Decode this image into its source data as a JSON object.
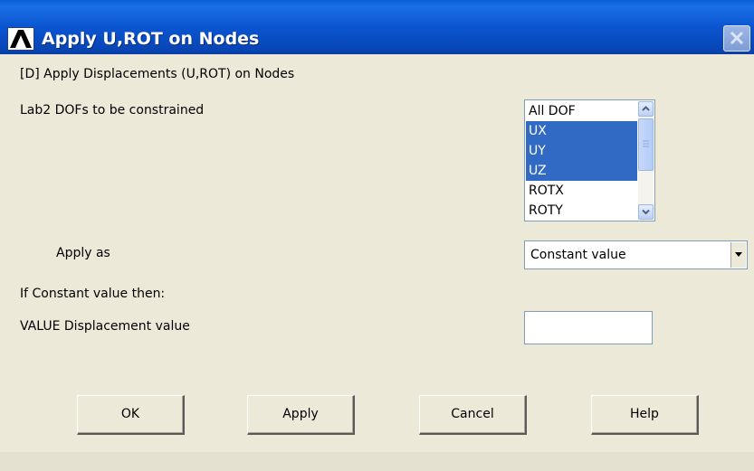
{
  "window": {
    "title": "Apply U,ROT on Nodes",
    "icon": "ansys-logo-icon",
    "close_icon": "close-icon"
  },
  "header_text": "[D]  Apply Displacements (U,ROT) on Nodes",
  "lab2": {
    "label": "Lab2    DOFs to be constrained",
    "options": [
      {
        "label": "All DOF",
        "selected": false
      },
      {
        "label": "UX",
        "selected": true
      },
      {
        "label": "UY",
        "selected": true
      },
      {
        "label": "UZ",
        "selected": true
      },
      {
        "label": "ROTX",
        "selected": false
      },
      {
        "label": "ROTY",
        "selected": false
      }
    ]
  },
  "apply_as": {
    "label": "Apply as",
    "value": "Constant value"
  },
  "constant_note": "If Constant value then:",
  "value_field": {
    "label": "VALUE   Displacement value",
    "value": ""
  },
  "buttons": {
    "ok": "OK",
    "apply": "Apply",
    "cancel": "Cancel",
    "help": "Help"
  },
  "colors": {
    "titlebar": "#0b55d1",
    "selection": "#316ac5",
    "dialog_bg": "#ece9d8"
  }
}
